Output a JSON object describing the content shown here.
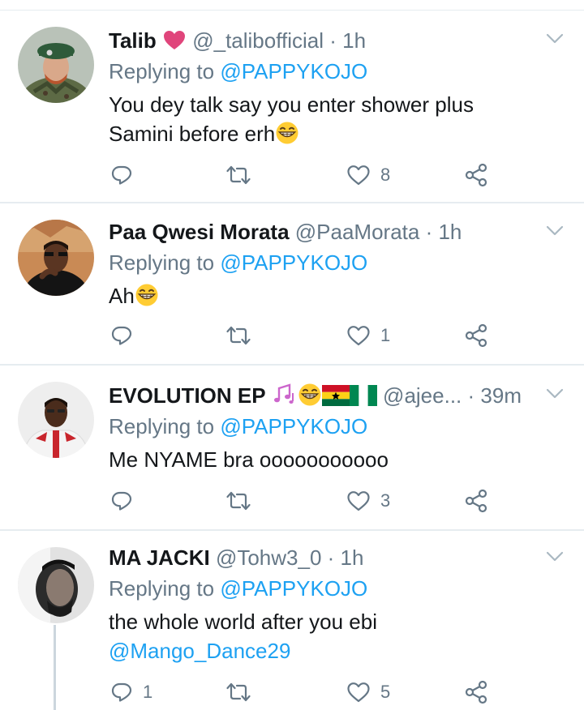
{
  "tweets": [
    {
      "name": "Talib",
      "handle": "@_talibofficial",
      "time": "· 1h",
      "replying_label": "Replying to",
      "replying_to": "@PAPPYKOJO",
      "text_line1": "You dey talk say you enter shower plus",
      "text_line2": "Samini  before erh",
      "reply_count": "",
      "retweet_count": "",
      "like_count": "8"
    },
    {
      "name": "Paa Qwesi Morata",
      "handle": "@PaaMorata",
      "time": "· 1h",
      "replying_label": "Replying to",
      "replying_to": "@PAPPYKOJO",
      "text_line1": "Ah",
      "reply_count": "",
      "retweet_count": "",
      "like_count": "1"
    },
    {
      "name": "EVOLUTION EP",
      "handle": "@ajee...",
      "time": "· 39m",
      "replying_label": "Replying to",
      "replying_to": "@PAPPYKOJO",
      "text_line1": "Me NYAME bra ooooooooooo",
      "reply_count": "",
      "retweet_count": "",
      "like_count": "3"
    },
    {
      "name": "MA JACKI",
      "handle": "@Tohw3_0",
      "time": "· 1h",
      "replying_label": "Replying to",
      "replying_to": "@PAPPYKOJO",
      "text_line1": "the whole world after you ebi",
      "text_line2": "@Mango_Dance29",
      "reply_count": "1",
      "retweet_count": "",
      "like_count": "5"
    }
  ],
  "colors": {
    "link": "#1da1f2",
    "secondary_text": "#657786",
    "icon": "#657786",
    "primary_text": "#14171a",
    "border": "#e6ecf0"
  },
  "icons": [
    "reply-icon",
    "retweet-icon",
    "like-icon",
    "share-icon",
    "chevron-down-icon",
    "heart-emoji",
    "grin-emoji",
    "music-notes-emoji",
    "ghana-flag-emoji",
    "nigeria-flag-emoji"
  ]
}
